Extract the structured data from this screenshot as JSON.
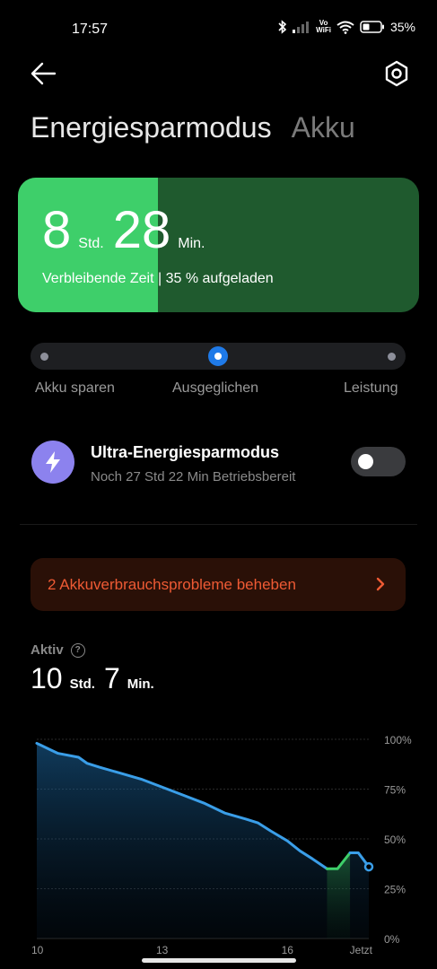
{
  "status_bar": {
    "time": "17:57",
    "vowifi_top": "Vo",
    "vowifi_bottom": "WiFi",
    "battery_percent": "35%",
    "icons": [
      "bluetooth-icon",
      "signal-icon",
      "vowifi-icon",
      "wifi-icon",
      "battery-icon"
    ]
  },
  "header": {
    "back_icon": "arrow-left-icon",
    "settings_icon": "gear-icon",
    "tabs": [
      {
        "label": "Energiesparmodus",
        "active": true
      },
      {
        "label": "Akku",
        "active": false
      }
    ]
  },
  "battery_card": {
    "hours": "8",
    "hours_unit": "Std.",
    "minutes": "28",
    "minutes_unit": "Min.",
    "remaining_text": "Verbleibende Zeit | 35 % aufgeladen",
    "charge_fraction": 0.35,
    "colors": {
      "fill": "#3ecf6a",
      "empty": "#1f5a2e"
    }
  },
  "mode_slider": {
    "options": [
      "Akku sparen",
      "Ausgeglichen",
      "Leistung"
    ],
    "selected_index": 1,
    "accent": "#1f7ae8"
  },
  "ultra_saver": {
    "icon": "lightning-bolt-icon",
    "title": "Ultra-Energiesparmodus",
    "subtitle": "Noch 27 Std 22 Min Betriebsbereit",
    "enabled": false
  },
  "issues_banner": {
    "text": "2 Akkuverbrauchsprobleme beheben",
    "icon": "chevron-right-icon",
    "color": "#ee5a34"
  },
  "active_usage": {
    "label": "Aktiv",
    "help_icon": "question-circle-icon",
    "help_glyph": "?",
    "hours": "10",
    "hours_unit": "Std.",
    "minutes": "7",
    "minutes_unit": "Min."
  },
  "chart_data": {
    "type": "area",
    "y_tick_labels": [
      "100%",
      "75%",
      "50%",
      "25%",
      "0%"
    ],
    "y_ticks": [
      100,
      75,
      50,
      25,
      0
    ],
    "ylim": [
      0,
      100
    ],
    "x_tick_labels": [
      "10",
      "13",
      "16",
      "Jetzt"
    ],
    "x_ticks": [
      10,
      13,
      16,
      17.95
    ],
    "xlim": [
      10,
      17.95
    ],
    "grid": true,
    "series": [
      {
        "role": "discharge",
        "color": "#3a9ee8",
        "x": [
          10,
          10.1,
          10.3,
          10.5,
          11.0,
          11.2,
          11.5,
          12.0,
          12.5,
          13.0,
          13.5,
          14.0,
          14.5,
          15.0,
          15.3,
          15.6,
          16.0,
          16.3,
          16.6,
          16.95
        ],
        "y": [
          98,
          97,
          95,
          93,
          91,
          88,
          86,
          83,
          80,
          76,
          72,
          68,
          63,
          60,
          58,
          54,
          49,
          44,
          40,
          35
        ]
      },
      {
        "role": "charging",
        "color": "#3ecf6a",
        "x": [
          16.95,
          17.2,
          17.5
        ],
        "y": [
          35,
          35,
          43
        ]
      },
      {
        "role": "discharge",
        "color": "#3a9ee8",
        "x": [
          17.5,
          17.7,
          17.95
        ],
        "y": [
          43,
          43,
          36
        ]
      }
    ],
    "charging_interval": [
      16.95,
      17.5
    ],
    "current_point": {
      "x": 17.95,
      "y": 36
    }
  }
}
